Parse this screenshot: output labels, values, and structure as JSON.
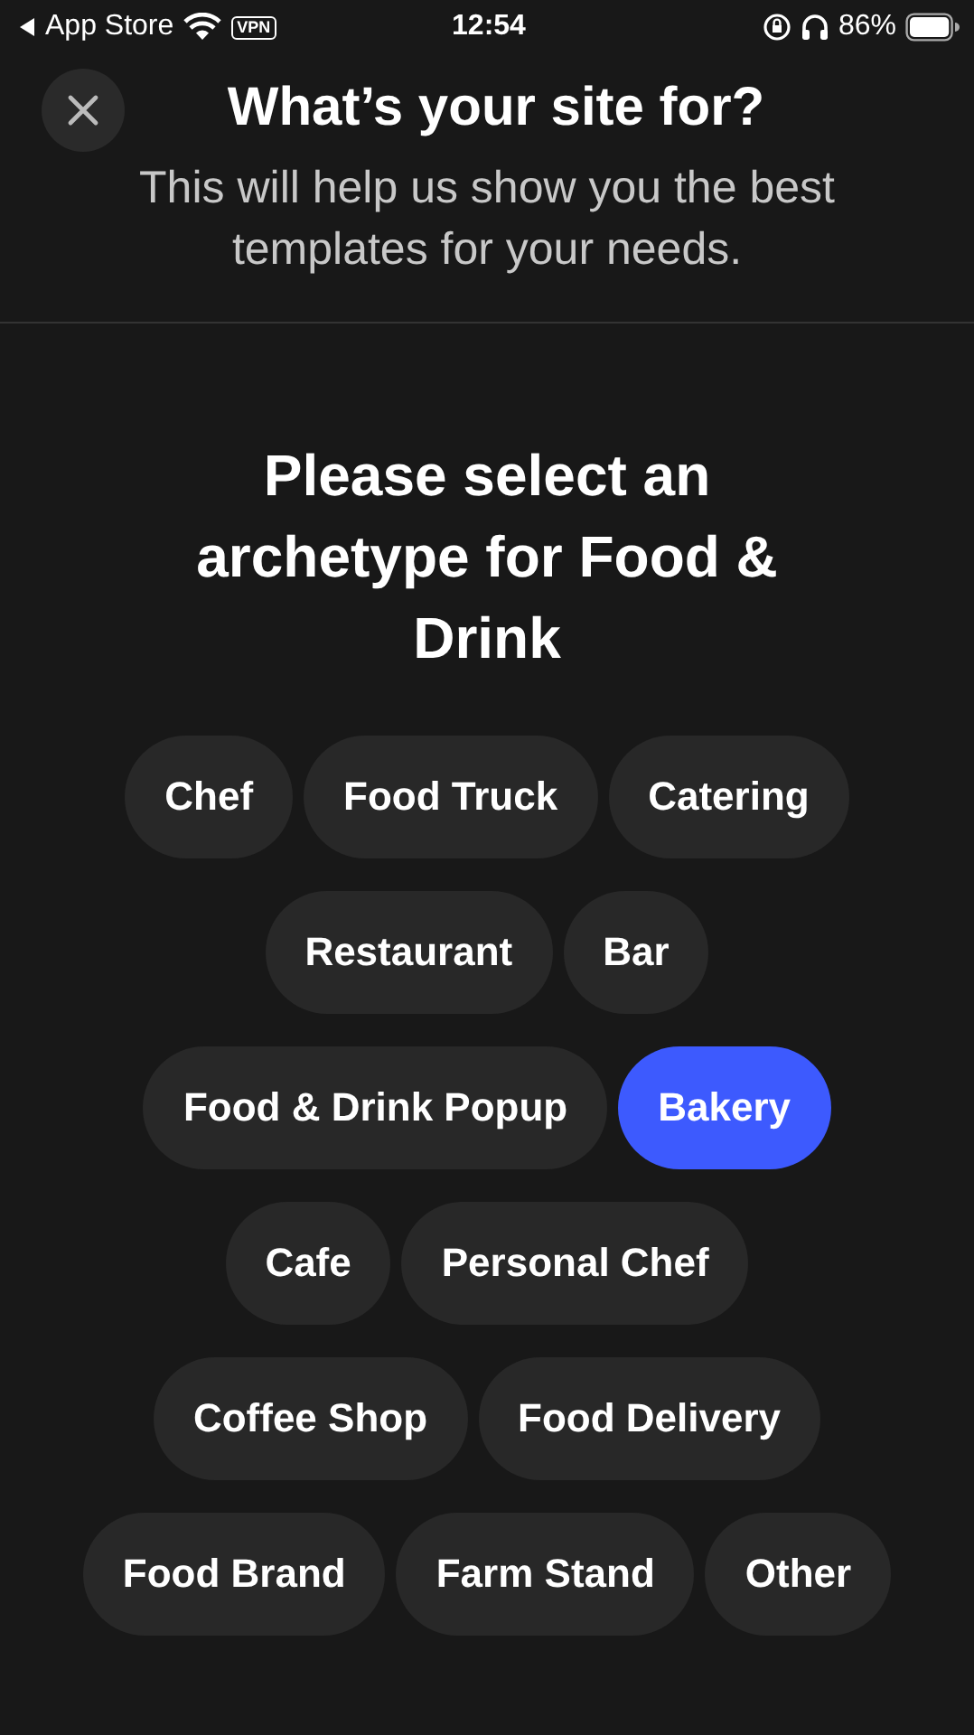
{
  "status_bar": {
    "back_label": "App Store",
    "vpn": "VPN",
    "time": "12:54",
    "battery": "86%"
  },
  "header": {
    "title": "What’s your site for?",
    "subtitle": "This will help us show you the best templates for your needs."
  },
  "heading": "Please select an archetype for Food & Drink",
  "chip_rows": [
    [
      {
        "label": "Chef",
        "selected": false
      },
      {
        "label": "Food Truck",
        "selected": false
      },
      {
        "label": "Catering",
        "selected": false
      }
    ],
    [
      {
        "label": "Restaurant",
        "selected": false
      },
      {
        "label": "Bar",
        "selected": false
      }
    ],
    [
      {
        "label": "Food & Drink Popup",
        "selected": false
      },
      {
        "label": "Bakery",
        "selected": true
      }
    ],
    [
      {
        "label": "Cafe",
        "selected": false
      },
      {
        "label": "Personal Chef",
        "selected": false
      }
    ],
    [
      {
        "label": "Coffee Shop",
        "selected": false
      },
      {
        "label": "Food Delivery",
        "selected": false
      }
    ],
    [
      {
        "label": "Food Brand",
        "selected": false
      },
      {
        "label": "Farm Stand",
        "selected": false
      },
      {
        "label": "Other",
        "selected": false
      }
    ]
  ]
}
